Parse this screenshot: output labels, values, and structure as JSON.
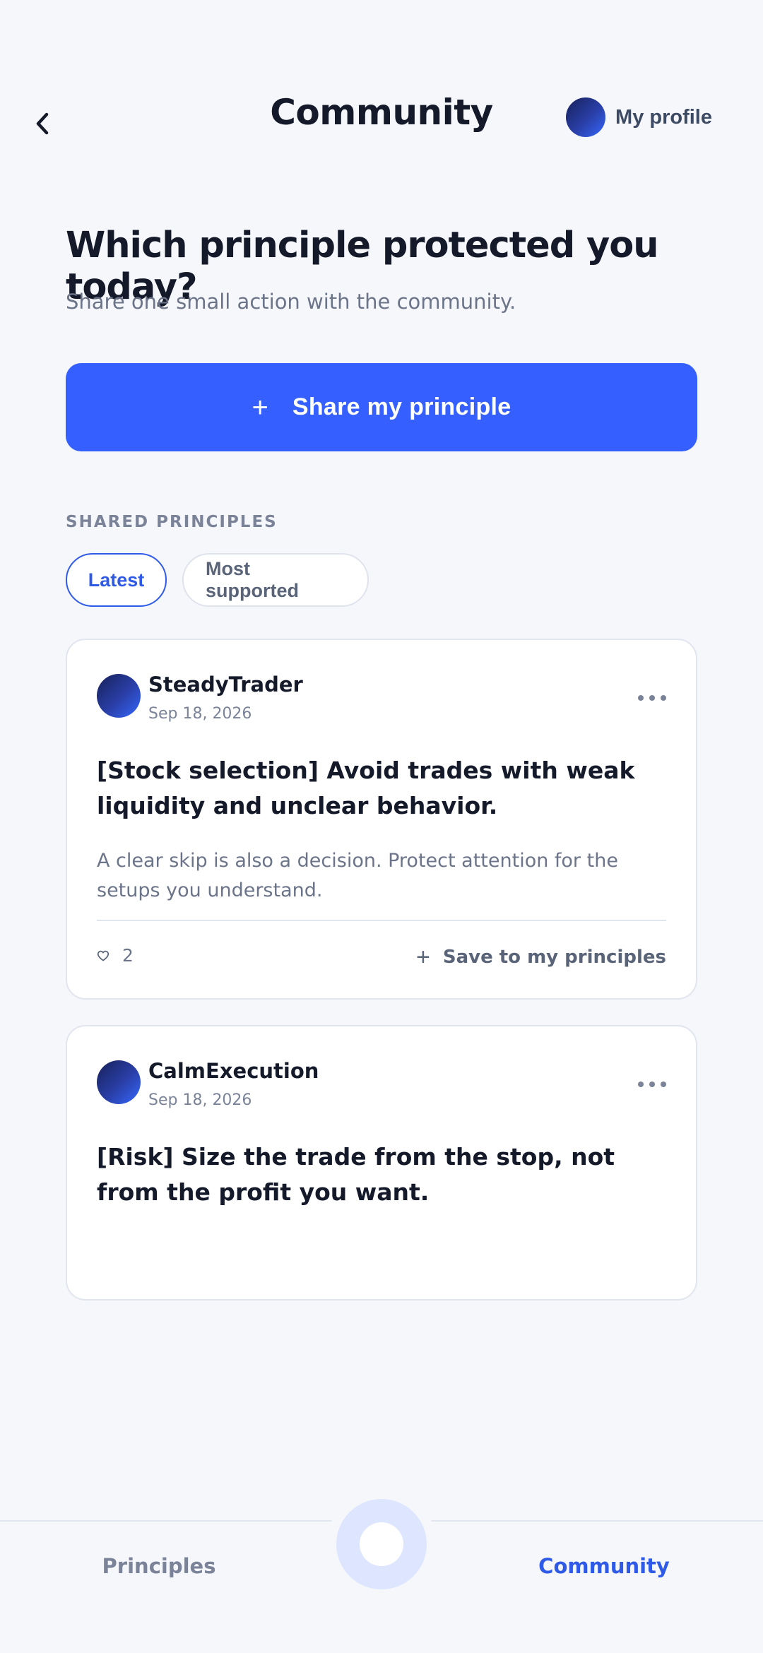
{
  "header": {
    "title": "Community",
    "profile_label": "My profile"
  },
  "hero": {
    "title": "Which principle protected you today?",
    "subtitle": "Share one small action with the community.",
    "share_button_label": "Share my principle"
  },
  "feed": {
    "section_label": "SHARED PRINCIPLES",
    "filters": [
      {
        "label": "Latest",
        "active": true
      },
      {
        "label": "Most supported",
        "active": false
      }
    ],
    "posts": [
      {
        "author": "SteadyTrader",
        "date": "Sep 18, 2026",
        "title": "[Stock selection] Avoid trades with weak liquidity and unclear behavior.",
        "body": "A clear skip is also a decision. Protect attention for the setups you understand.",
        "likes": "2",
        "save_label": "Save to my principles"
      },
      {
        "author": "CalmExecution",
        "date": "Sep 18, 2026",
        "title": "[Risk] Size the trade from the stop, not from the profit you want."
      }
    ]
  },
  "bottom_nav": {
    "items": [
      {
        "label": "Principles",
        "active": false
      },
      {
        "label": "Community",
        "active": true
      }
    ]
  },
  "colors": {
    "accent": "#3560ff",
    "accent_text": "#2f5ae8",
    "background": "#f6f7fb",
    "fab": "#dde5ff"
  },
  "icons": {
    "back": "chevron-left-icon",
    "share": "plus-icon",
    "more": "more-horizontal-icon",
    "like": "heart-icon",
    "save": "plus-icon"
  }
}
